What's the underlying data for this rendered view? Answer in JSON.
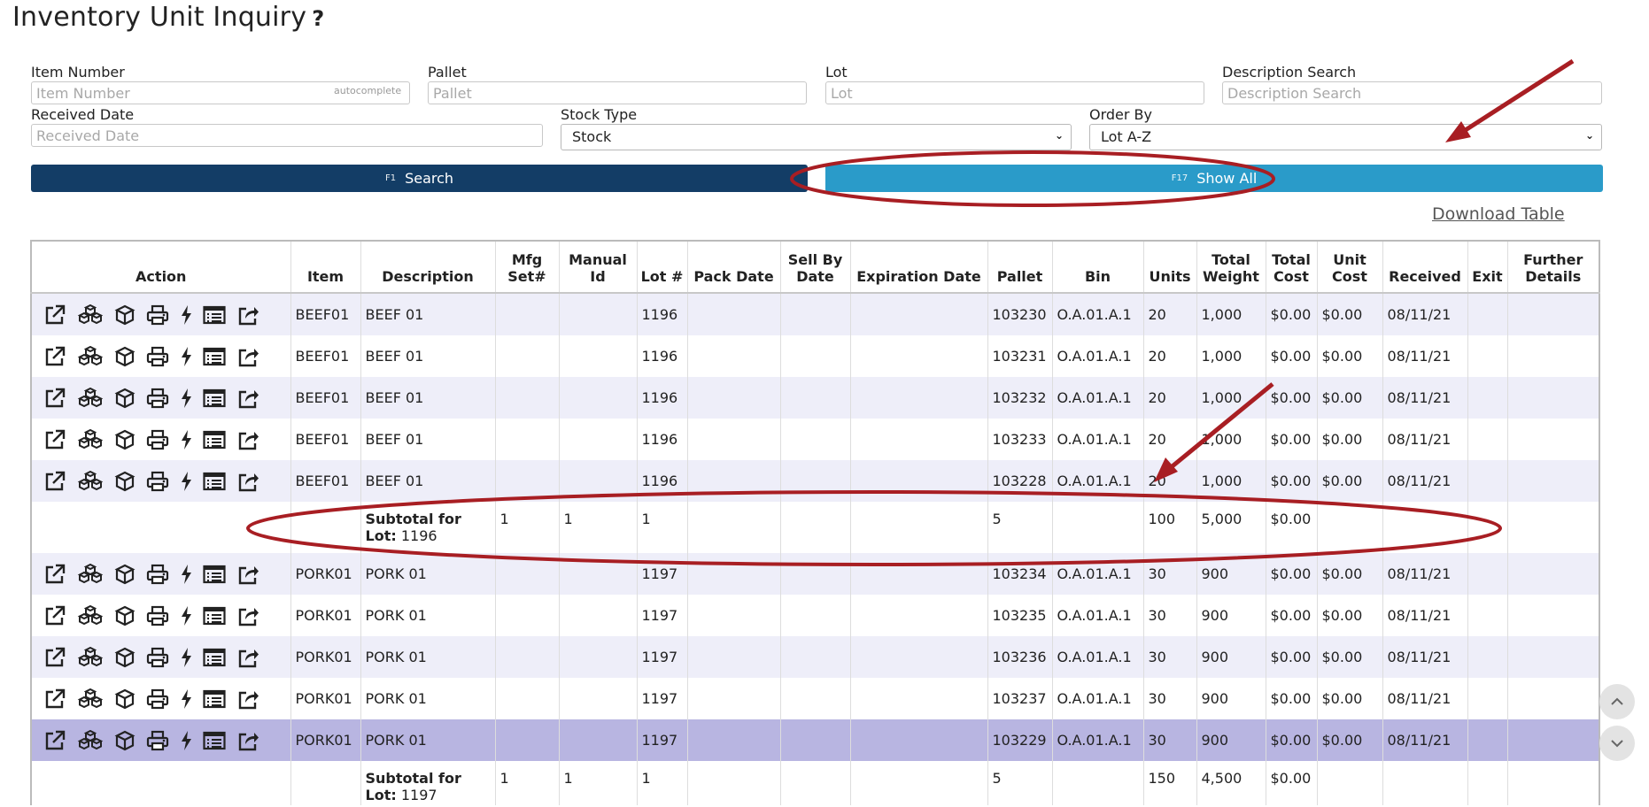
{
  "page": {
    "title": "Inventory Unit Inquiry",
    "help_glyph": "?"
  },
  "filters": {
    "item_number": {
      "label": "Item Number",
      "placeholder": "Item Number",
      "hint": "autocomplete"
    },
    "pallet": {
      "label": "Pallet",
      "placeholder": "Pallet"
    },
    "lot": {
      "label": "Lot",
      "placeholder": "Lot"
    },
    "description_search": {
      "label": "Description Search",
      "placeholder": "Description Search"
    },
    "received_date": {
      "label": "Received Date",
      "placeholder": "Received Date"
    },
    "stock_type": {
      "label": "Stock Type",
      "value": "Stock"
    },
    "order_by": {
      "label": "Order By",
      "value": "Lot A-Z"
    }
  },
  "buttons": {
    "search": {
      "key": "F1",
      "label": "Search"
    },
    "show_all": {
      "key": "F17",
      "label": "Show All"
    }
  },
  "download_label": "Download Table",
  "table": {
    "headers": [
      "Action",
      "Item",
      "Description",
      "Mfg Set#",
      "Manual Id",
      "Lot #",
      "Pack Date",
      "Sell By Date",
      "Expiration Date",
      "Pallet",
      "Bin",
      "Units",
      "Total Weight",
      "Total Cost",
      "Unit Cost",
      "Received",
      "Exit",
      "Further Details"
    ],
    "rows": [
      {
        "item": "BEEF01",
        "description": "BEEF 01",
        "lot": "1196",
        "pallet": "103230",
        "bin": "O.A.01.A.1",
        "units": "20",
        "weight": "1,000",
        "total_cost": "$0.00",
        "unit_cost": "$0.00",
        "received": "08/11/21"
      },
      {
        "item": "BEEF01",
        "description": "BEEF 01",
        "lot": "1196",
        "pallet": "103231",
        "bin": "O.A.01.A.1",
        "units": "20",
        "weight": "1,000",
        "total_cost": "$0.00",
        "unit_cost": "$0.00",
        "received": "08/11/21"
      },
      {
        "item": "BEEF01",
        "description": "BEEF 01",
        "lot": "1196",
        "pallet": "103232",
        "bin": "O.A.01.A.1",
        "units": "20",
        "weight": "1,000",
        "total_cost": "$0.00",
        "unit_cost": "$0.00",
        "received": "08/11/21"
      },
      {
        "item": "BEEF01",
        "description": "BEEF 01",
        "lot": "1196",
        "pallet": "103233",
        "bin": "O.A.01.A.1",
        "units": "20",
        "weight": "1,000",
        "total_cost": "$0.00",
        "unit_cost": "$0.00",
        "received": "08/11/21"
      },
      {
        "item": "BEEF01",
        "description": "BEEF 01",
        "lot": "1196",
        "pallet": "103228",
        "bin": "O.A.01.A.1",
        "units": "20",
        "weight": "1,000",
        "total_cost": "$0.00",
        "unit_cost": "$0.00",
        "received": "08/11/21"
      }
    ],
    "subtotal1": {
      "label_bold": "Subtotal for Lot:",
      "lot": "1196",
      "mfg": "1",
      "manual": "1",
      "lot_count": "1",
      "pallet": "5",
      "units": "100",
      "weight": "5,000",
      "total_cost": "$0.00"
    },
    "rows2": [
      {
        "item": "PORK01",
        "description": "PORK 01",
        "lot": "1197",
        "pallet": "103234",
        "bin": "O.A.01.A.1",
        "units": "30",
        "weight": "900",
        "total_cost": "$0.00",
        "unit_cost": "$0.00",
        "received": "08/11/21"
      },
      {
        "item": "PORK01",
        "description": "PORK 01",
        "lot": "1197",
        "pallet": "103235",
        "bin": "O.A.01.A.1",
        "units": "30",
        "weight": "900",
        "total_cost": "$0.00",
        "unit_cost": "$0.00",
        "received": "08/11/21"
      },
      {
        "item": "PORK01",
        "description": "PORK 01",
        "lot": "1197",
        "pallet": "103236",
        "bin": "O.A.01.A.1",
        "units": "30",
        "weight": "900",
        "total_cost": "$0.00",
        "unit_cost": "$0.00",
        "received": "08/11/21"
      },
      {
        "item": "PORK01",
        "description": "PORK 01",
        "lot": "1197",
        "pallet": "103237",
        "bin": "O.A.01.A.1",
        "units": "30",
        "weight": "900",
        "total_cost": "$0.00",
        "unit_cost": "$0.00",
        "received": "08/11/21"
      },
      {
        "item": "PORK01",
        "description": "PORK 01",
        "lot": "1197",
        "pallet": "103229",
        "bin": "O.A.01.A.1",
        "units": "30",
        "weight": "900",
        "total_cost": "$0.00",
        "unit_cost": "$0.00",
        "received": "08/11/21"
      }
    ],
    "subtotal2": {
      "label_bold": "Subtotal for Lot:",
      "lot": "1197",
      "mfg": "1",
      "manual": "1",
      "lot_count": "1",
      "pallet": "5",
      "units": "150",
      "weight": "4,500",
      "total_cost": "$0.00"
    }
  },
  "action_icons": [
    "open-external-icon",
    "boxes-icon",
    "box-icon",
    "print-icon",
    "bolt-icon",
    "list-icon",
    "share-icon"
  ],
  "colors": {
    "search_button": "#133d66",
    "show_all_button": "#2a9bc9",
    "annotation": "#a81e23",
    "selected_row": "#b8b5e1",
    "striped_row": "#eeeef9"
  }
}
